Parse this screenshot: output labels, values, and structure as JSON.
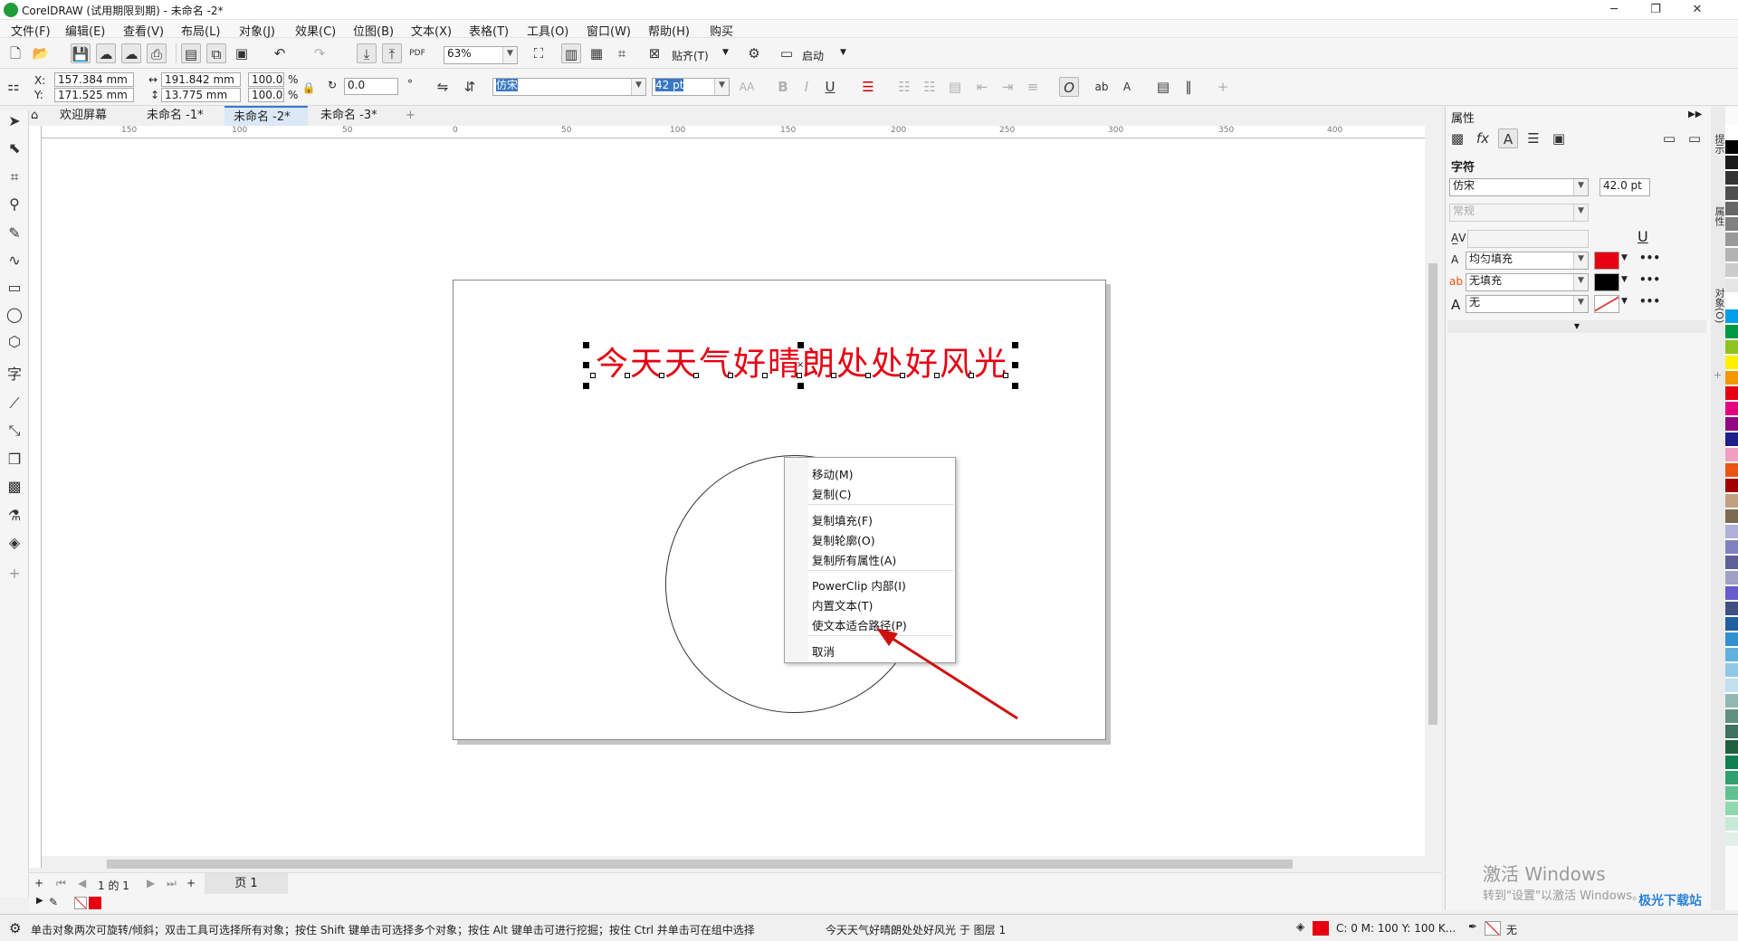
{
  "title": "CorelDRAW (试用期限到期) - 未命名 -2*",
  "menu": [
    "文件(F)",
    "编辑(E)",
    "查看(V)",
    "布局(L)",
    "对象(J)",
    "效果(C)",
    "位图(B)",
    "文本(X)",
    "表格(T)",
    "工具(O)",
    "窗口(W)",
    "帮助(H)",
    "购买"
  ],
  "toolbar1": {
    "zoom": "63%",
    "snap": "贴齐(T)",
    "launch": "启动"
  },
  "propbar": {
    "x": "157.384 mm",
    "y": "171.525 mm",
    "w": "191.842 mm",
    "h": "13.775 mm",
    "sx": "100.0",
    "sy": "100.0",
    "pct": "%",
    "rotation": "0.0",
    "font": "仿宋",
    "size": "42 pt"
  },
  "tabs": [
    "欢迎屏幕",
    "未命名 -1*",
    "未命名 -2*",
    "未命名 -3*"
  ],
  "ruler_h": [
    "150",
    "100",
    "50",
    "0",
    "50",
    "100",
    "150",
    "200",
    "250",
    "300",
    "350",
    "400"
  ],
  "canvas_text": "今天天气好晴朗处处好风光",
  "context_menu": [
    "移动(M)",
    "复制(C)",
    "复制填充(F)",
    "复制轮廓(O)",
    "复制所有属性(A)",
    "PowerClip 内部(I)",
    "内置文本(T)",
    "使文本适合路径(P)",
    "取消"
  ],
  "pagebar": {
    "pages": "1 的 1",
    "page_tab": "页 1"
  },
  "status": {
    "hint": "单击对象两次可旋转/倾斜；双击工具可选择所有对象；按住 Shift 键单击可选择多个对象；按住 Alt 键单击可进行挖掘；按住 Ctrl 并单击可在组中选择",
    "object": "今天天气好晴朗处处好风光 于 图层 1",
    "color": "C: 0 M: 100 Y: 100 K...",
    "outline": "无"
  },
  "panel": {
    "title": "属性",
    "section": "字符",
    "font": "仿宋",
    "size": "42.0 pt",
    "style": "常规",
    "fill1": "均匀填充",
    "fill2": "无填充",
    "outline": "无"
  },
  "docker_tabs": [
    "提示",
    "属性",
    "对象(O)"
  ],
  "watermark": {
    "line1": "激活 Windows",
    "line2": "转到\"设置\"以激活 Windows。"
  },
  "site_badge": "极光下载站",
  "colors": {
    "text_red": "#e60012",
    "accent": "#3a78c4"
  },
  "palette": [
    "#ffffff",
    "#000000",
    "#1a1a1a",
    "#333333",
    "#4d4d4d",
    "#666666",
    "#808080",
    "#999999",
    "#b3b3b3",
    "#cccccc",
    "#e6e6e6",
    "#ffffff",
    "#00a0e9",
    "#009944",
    "#8fc31f",
    "#fff100",
    "#f39800",
    "#e60012",
    "#e4007f",
    "#920783",
    "#1d2088",
    "#f19ec2",
    "#ea5514",
    "#a40000",
    "#c0a080",
    "#7d6b4f",
    "#b0b0d8",
    "#8080c0",
    "#606098",
    "#a0a0c8",
    "#6a5acd",
    "#405080",
    "#2060a0",
    "#3090d0",
    "#60b0e0",
    "#90c8e8",
    "#c0e0f0",
    "#90b8b0",
    "#609080",
    "#407060",
    "#206040",
    "#108050",
    "#30a070",
    "#60c090",
    "#90d8b0",
    "#c8e8d8",
    "#e0f0e8"
  ]
}
